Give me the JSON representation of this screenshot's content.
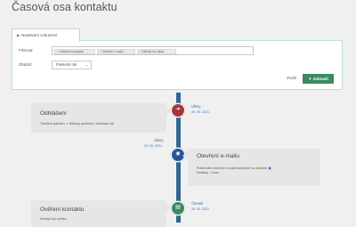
{
  "page": {
    "title": "Časová osa kontaktu"
  },
  "filter": {
    "tab_label": "Nastavení zobrazení",
    "filter_label": "Filtrovat:",
    "tags": [
      "Odeslání kampaně",
      "Otevření e-mailu",
      "Kliknutí na odkaz"
    ],
    "period_label": "Období:",
    "period_value": "Poslední rok",
    "reset_label": "Zrušit",
    "show_label": "Zobrazit",
    "accent_color": "#3c8a63"
  },
  "timeline": {
    "line_color": "#30678f",
    "events": [
      {
        "id": "unsubscribe",
        "title": "Odhlášení",
        "detail_prefix": "Timeline (zařízení",
        "detail_suffix": "Netlový prohlížeč, Windows 10)",
        "sender": "Ubisy",
        "date": "25. 05. 2021",
        "color": "#a8353d",
        "icon": "door-exit-icon"
      },
      {
        "id": "email-open",
        "title": "Otevření e-mailu",
        "detail_prefix": "Potenciální otevření e-mailu kampaně na zařízení",
        "detail_suffix": "Desktop - Linux",
        "sender": "Ubisy",
        "date": "25. 05. 2021",
        "color": "#27539a",
        "icon": "eye-icon"
      },
      {
        "id": "confirm-contact",
        "title": "Ověření kontaktu",
        "detail_prefix": "Kontakt byl ověřen",
        "detail_suffix": "",
        "sender": "Ćtenek",
        "date": "25. 05. 2021",
        "color": "#3c8a63",
        "icon": "check-doc-icon"
      }
    ]
  }
}
